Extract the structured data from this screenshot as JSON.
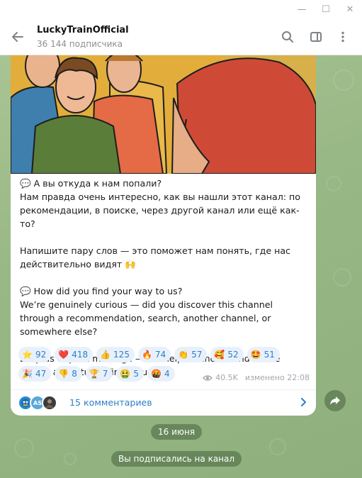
{
  "window": {
    "minimize_glyph": "—",
    "maximize_glyph": "☐",
    "close_glyph": "✕"
  },
  "header": {
    "channel_name": "LuckyTrainOfficial",
    "subscribers": "36 144 подписчика",
    "icons": [
      "back-arrow-icon",
      "search-icon",
      "sidebar-toggle-icon",
      "more-vertical-icon"
    ]
  },
  "post": {
    "text": "💬 А вы откуда к нам попали?\nНам правда очень интересно, как вы нашли этот канал: по рекомендации, в поиске, через другой канал или ещё как-то?\n\nНапишите пару слов — это поможет нам понять, где нас действительно видят 🙌\n\n💬 How did you find your way to us?\nWe’re genuinely curious — did you discover this channel through a recommendation, search, another channel, or somewhere else?\n\nDrop us a quick message — it’ll help us understand where people are actually finding us 🙌",
    "reactions_row1": [
      {
        "emoji": "⭐",
        "count": "92"
      },
      {
        "emoji": "❤️",
        "count": "418"
      },
      {
        "emoji": "👍",
        "count": "125"
      },
      {
        "emoji": "🔥",
        "count": "74"
      },
      {
        "emoji": "👏",
        "count": "57"
      },
      {
        "emoji": "🥰",
        "count": "52"
      },
      {
        "emoji": "🤩",
        "count": "51"
      }
    ],
    "reactions_row2": [
      {
        "emoji": "🎉",
        "count": "47"
      },
      {
        "emoji": "👎",
        "count": "8"
      },
      {
        "emoji": "🏆",
        "count": "7"
      },
      {
        "emoji": "🤮",
        "count": "5"
      },
      {
        "emoji": "🤬",
        "count": "4"
      }
    ],
    "views": "40.5K",
    "edited_time": "изменено 22:08",
    "comments_label": "15 комментариев",
    "comment_avatar_initials": "AS"
  },
  "date_badge": "16 июня",
  "service_message": "Вы подписались на канал",
  "colors": {
    "accent": "#2f7ec4",
    "reaction_bg": "#e8f1fb",
    "chat_bg": "#9cb98a"
  }
}
